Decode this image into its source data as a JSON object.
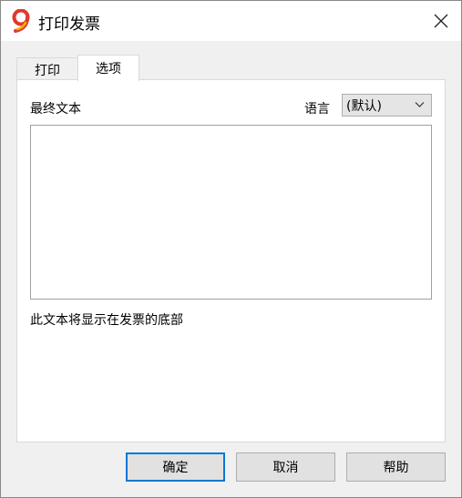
{
  "window": {
    "title": "打印发票"
  },
  "tabs": [
    {
      "label": "打印"
    },
    {
      "label": "选项"
    }
  ],
  "options": {
    "final_text_label": "最终文本",
    "language_label": "语言",
    "language_value": "(默认)",
    "final_text_value": "",
    "hint": "此文本将显示在发票的底部"
  },
  "buttons": {
    "ok": "确定",
    "cancel": "取消",
    "help": "帮助"
  },
  "colors": {
    "accent": "#0078d7",
    "logo_red": "#e0382c",
    "logo_yellow": "#f5b400"
  }
}
